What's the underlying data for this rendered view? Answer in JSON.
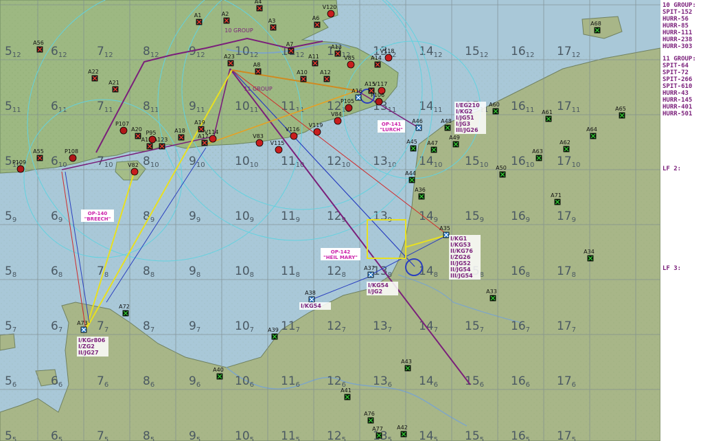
{
  "grid": {
    "cols": [
      "5",
      "6",
      "7",
      "8",
      "9",
      "10",
      "11",
      "12",
      "13",
      "14",
      "15",
      "16",
      "17"
    ],
    "rows": [
      "12",
      "11",
      "10",
      "9",
      "8",
      "7",
      "6",
      "5"
    ]
  },
  "bases": {
    "A1": "A1",
    "A2": "A2",
    "A3": "A3",
    "A4": "A4",
    "A6": "A6",
    "A7": "A7",
    "A8": "A8",
    "A10": "A10",
    "A11": "A11",
    "A12": "A12",
    "A13": "A13",
    "A14": "A14",
    "A15": "A15",
    "A16": "A16",
    "A17": "A17",
    "A18": "A18",
    "A19": "A19",
    "A20": "A20",
    "A21": "A21",
    "A22": "A22",
    "A23": "A23",
    "A33": "A33",
    "A34": "A34",
    "A35": "A35",
    "A36": "A36",
    "A37": "A37",
    "A38": "A38",
    "A39": "A39",
    "A40": "A40",
    "A41": "A41",
    "A42": "A42",
    "A43": "A43",
    "A44": "A44",
    "A45": "A45",
    "A46": "A46",
    "A47": "A47",
    "A48": "A48",
    "A49": "A49",
    "A50": "A50",
    "A55": "A55",
    "A56": "A56",
    "A60": "A60",
    "A61": "A61",
    "A62": "A62",
    "A63": "A63",
    "A64": "A64",
    "A65": "A65",
    "A68": "A68",
    "A71": "A71",
    "A72": "A72",
    "A73": "A73",
    "A76": "A76",
    "A77": "A77",
    "A123a": "A123",
    "A123b": "A123",
    "V82": "V82",
    "V83": "V83",
    "V84": "V84",
    "V85": "V85",
    "V114": "V114",
    "V115": "V115",
    "V116": "V116",
    "V117": "V117",
    "V118": "V118",
    "V119": "V119",
    "V120": "V120",
    "P95": "P95",
    "P105": "P105",
    "P106": "P106",
    "P107": "P107",
    "P108": "P108",
    "P109": "P109"
  },
  "map_labels": {
    "group10": "10 GROUP",
    "group11": "11 GROUP",
    "op140_a": "OP-140",
    "op140_b": "\"BREECH\"",
    "op141_a": "OP-141",
    "op141_b": "\"LURCH\"",
    "op142_a": "OP-142",
    "op142_b": "\"HEIL MARY\""
  },
  "unit_stacks": {
    "a35": [
      "I/KG1",
      "I/KG53",
      "II/KG76",
      "I/ZG26",
      "II/JG52",
      "II/JG54",
      "III/JG54"
    ],
    "a48": [
      "I/EG210",
      "I/KG2",
      "I/JG51",
      "I/JG3",
      "III/JG26"
    ],
    "a37": [
      "I/KG54",
      "I/JG2"
    ],
    "a38": [
      "I/KG54"
    ],
    "a73": [
      "I/KGr806",
      "I/ZG2",
      "II/JG27"
    ]
  },
  "sidebar": {
    "group10_title": "10 GROUP:",
    "group10": [
      "SPIT-152",
      "HURR-56",
      "HURR-85",
      "HURR-111",
      "HURR-238",
      "HURR-303"
    ],
    "group11_title": "11 GROUP:",
    "group11": [
      "SPIT-64",
      "SPIT-72",
      "SPIT-266",
      "SPIT-610",
      "HURR-43",
      "HURR-145",
      "HURR-401",
      "HURR-501"
    ],
    "lf2": "LF 2:",
    "lf3": "LF 3:"
  },
  "colors": {
    "sea": "#a9c8d8",
    "land_uk": "#9db882",
    "land_fr": "#a8b688",
    "grid": "#7f8c90",
    "raf_route": "#7a1f7a",
    "luft_blue": "#2a3fbf",
    "luft_red": "#d02a2a",
    "yellow": "#e8e020",
    "cyan_ring": "#62d2df"
  }
}
